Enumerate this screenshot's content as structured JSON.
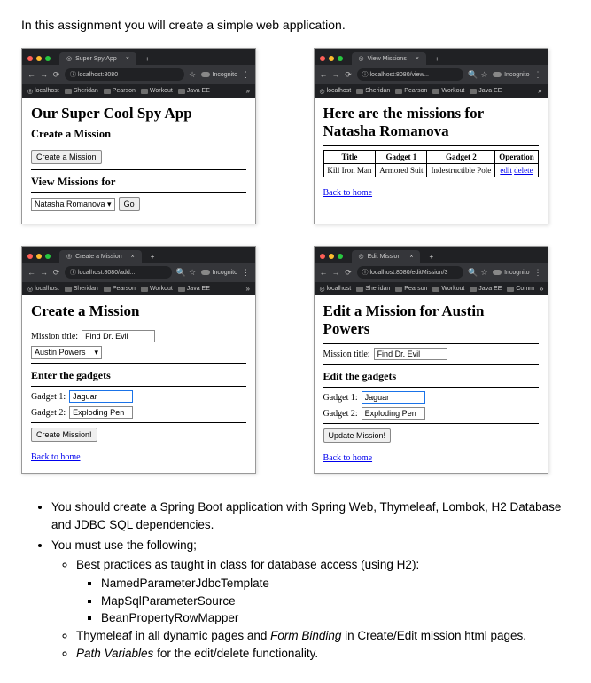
{
  "intro": "In this assignment you will create a simple web application.",
  "chrome": {
    "incognito": "Incognito",
    "menu_dots": "⋮",
    "back": "←",
    "fwd": "→",
    "reload": "⟳",
    "lock": "ⓘ",
    "star": "☆",
    "search": "🔍",
    "plus": "+",
    "close_x": "×",
    "chev": "»",
    "bookmarks": [
      "localhost",
      "Sheridan",
      "Pearson",
      "Workout",
      "Java EE"
    ],
    "bookmarks_ext": [
      "localhost",
      "Sheridan",
      "Pearson",
      "Workout",
      "Java EE",
      "Comm"
    ]
  },
  "shot1": {
    "tab_title": "Super Spy App",
    "url": "localhost:8080",
    "h1": "Our Super Cool Spy App",
    "h2a": "Create a Mission",
    "btn_create": "Create a Mission",
    "h2b": "View Missions for",
    "sel_value": "Natasha Romanova",
    "btn_go": "Go"
  },
  "shot2": {
    "tab_title": "View Missions",
    "url": "localhost:8080/view...",
    "h1a": "Here are the missions for",
    "h1b": "Natasha Romanova",
    "th": [
      "Title",
      "Gadget 1",
      "Gadget 2",
      "Operation"
    ],
    "row": [
      "Kill Iron Man",
      "Armored Suit",
      "Indestructible Pole"
    ],
    "op_edit": "edit",
    "op_delete": "delete",
    "back": "Back to home"
  },
  "shot3": {
    "tab_title": "Create a Mission",
    "url": "localhost:8080/add...",
    "h1": "Create a Mission",
    "lbl_title": "Mission title:",
    "val_title": "Find Dr. Evil",
    "sel_agent": "Austin Powers",
    "h2": "Enter the gadgets",
    "lbl_g1": "Gadget 1:",
    "val_g1": "Jaguar",
    "lbl_g2": "Gadget 2:",
    "val_g2": "Exploding Pen",
    "btn": "Create Mission!",
    "back": "Back to home"
  },
  "shot4": {
    "tab_title": "Edit Mission",
    "url": "localhost:8080/editMission/3",
    "h1a": "Edit a Mission for Austin",
    "h1b": "Powers",
    "lbl_title": "Mission title:",
    "val_title": "Find Dr. Evil",
    "h2": "Edit the gadgets",
    "lbl_g1": "Gadget 1:",
    "val_g1": "Jaguar",
    "lbl_g2": "Gadget 2:",
    "val_g2": "Exploding Pen",
    "btn": "Update Mission!",
    "back": "Back to home"
  },
  "instr": {
    "b1": "You should create a Spring Boot application with Spring Web, Thymeleaf, Lombok, H2 Database and JDBC SQL dependencies.",
    "b2": "You must use the following;",
    "s1": "Best practices as taught in class for database access (using H2):",
    "s1a": "NamedParameterJdbcTemplate",
    "s1b": "MapSqlParameterSource",
    "s1c": "BeanPropertyRowMapper",
    "s2_pre": "Thymeleaf in all dynamic pages and ",
    "s2_em": "Form Binding",
    "s2_post": " in Create/Edit mission html pages.",
    "s3_em": "Path Variables",
    "s3_post": " for the edit/delete functionality."
  }
}
